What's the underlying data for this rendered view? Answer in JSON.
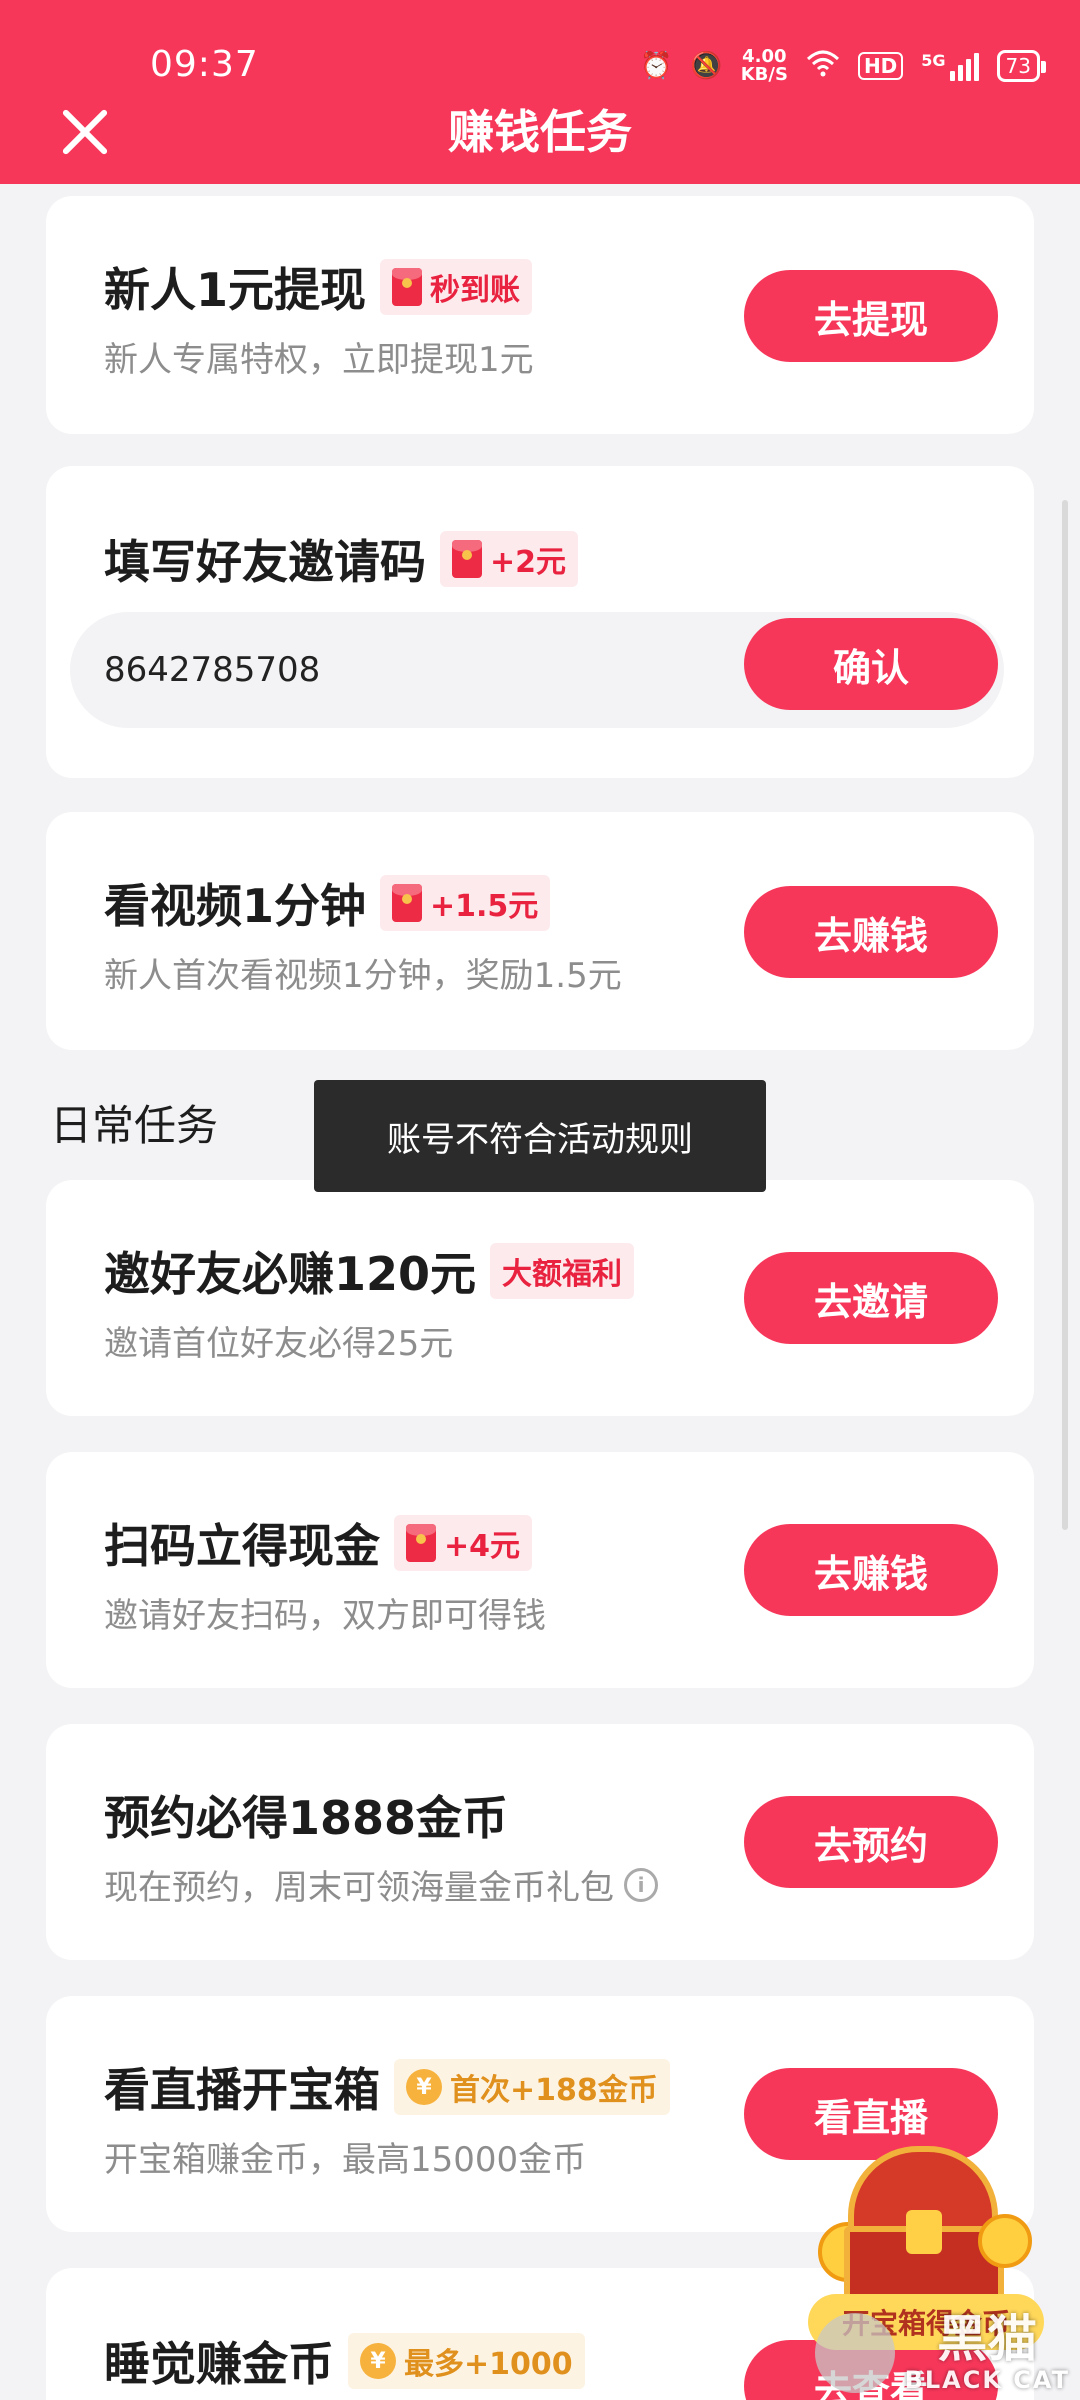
{
  "status_bar": {
    "time": "09:37",
    "speed_value": "4.00",
    "speed_unit": "KB/S",
    "hd": "HD",
    "network": "5G",
    "battery": "73",
    "icons": [
      "alarm-icon",
      "mute-icon",
      "wifi-icon",
      "hd-icon",
      "signal-icon",
      "battery-icon"
    ]
  },
  "header": {
    "title": "赚钱任务",
    "close_icon": "close-icon"
  },
  "tasks_top": [
    {
      "title": "新人1元提现",
      "badge": "秒到账",
      "badge_icon": "red-packet-icon",
      "subtitle": "新人专属特权，立即提现1元",
      "button": "去提现"
    },
    {
      "title": "填写好友邀请码",
      "badge": "+2元",
      "badge_icon": "red-packet-icon",
      "input_value": "8642785708",
      "button": "确认"
    },
    {
      "title": "看视频1分钟",
      "badge": "+1.5元",
      "badge_icon": "red-packet-icon",
      "subtitle": "新人首次看视频1分钟，奖励1.5元",
      "button": "去赚钱"
    }
  ],
  "daily_section": {
    "heading": "日常任务"
  },
  "toast": "账号不符合活动规则",
  "tasks_daily": [
    {
      "title": "邀好友必赚120元",
      "badge": "大额福利",
      "subtitle": "邀请首位好友必得25元",
      "button": "去邀请"
    },
    {
      "title": "扫码立得现金",
      "badge": "+4元",
      "badge_icon": "red-packet-icon",
      "subtitle": "邀请好友扫码，双方即可得钱",
      "button": "去赚钱"
    },
    {
      "title": "预约必得1888金币",
      "subtitle": "现在预约，周末可领海量金币礼包",
      "button": "去预约"
    },
    {
      "title": "看直播开宝箱",
      "badge": "首次+188金币",
      "badge_icon": "coin-icon",
      "coin_symbol": "¥",
      "subtitle": "开宝箱赚金币，最高15000金币",
      "button": "看直播"
    },
    {
      "title": "睡觉赚金币",
      "badge": "最多+1000",
      "badge_icon": "coin-icon",
      "coin_symbol": "¥",
      "button": "去查看"
    }
  ],
  "float_widget": {
    "label": "开宝箱得金币",
    "icon": "treasure-chest-icon"
  },
  "watermark": {
    "big": "黑猫",
    "small": "BLACK CAT"
  },
  "colors": {
    "primary": "#f7375a",
    "background": "#f3f3f5",
    "card": "#ffffff",
    "badge_red": "#e8223f",
    "badge_gold": "#e0901c"
  }
}
